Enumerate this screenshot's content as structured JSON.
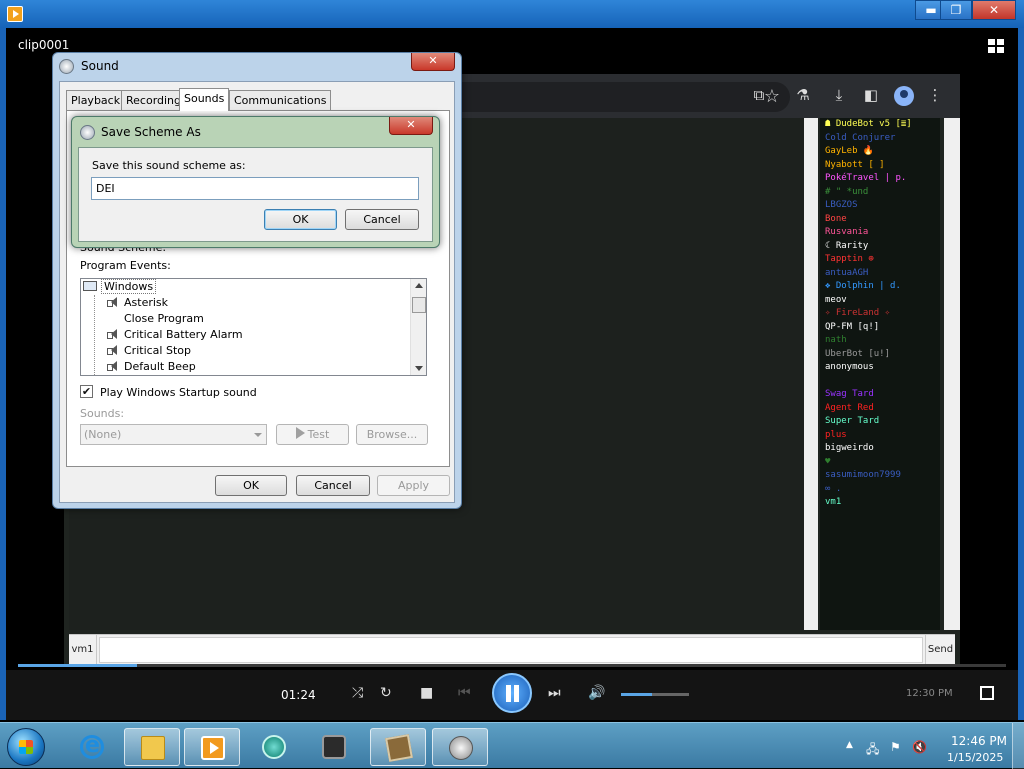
{
  "media_player": {
    "clip_name": "clip0001",
    "elapsed_time": "01:24",
    "progress": 0.12,
    "volume": 0.45,
    "window_controls": {
      "minimize": "▬",
      "maximize": "❐",
      "close": "✕"
    }
  },
  "chat": {
    "nick": "vm1",
    "send_label": "Send",
    "message_input_value": "",
    "users": [
      {
        "name": "☗ DudeBot v5 [≣]",
        "color": "#ffff55"
      },
      {
        "name": "Cold Conjurer",
        "color": "#3a5dc2"
      },
      {
        "name": "GayLeb 🔥",
        "color": "#ffb300"
      },
      {
        "name": "Nyabott [ ]",
        "color": "#ffb300"
      },
      {
        "name": "PokéTravel | p.",
        "color": "#ff55ff"
      },
      {
        "name": "# \" *und",
        "color": "#3a8f3a"
      },
      {
        "name": "LBGZOS",
        "color": "#3a5dc2"
      },
      {
        "name": "Bone",
        "color": "#ff4444"
      },
      {
        "name": "Rusvania",
        "color": "#ff5599"
      },
      {
        "name": "☾ Rarity",
        "color": "#ffffff"
      },
      {
        "name": "Tapptin ⊕",
        "color": "#ff3333"
      },
      {
        "name": "antuaAGH",
        "color": "#3a5dc2"
      },
      {
        "name": "❖ Dolphin | d.",
        "color": "#3399ff"
      },
      {
        "name": "meov",
        "color": "#ffffff"
      },
      {
        "name": "✧ FireLand ✧",
        "color": "#cc3333"
      },
      {
        "name": "QP-FM [q!]",
        "color": "#ffffff"
      },
      {
        "name": "nath",
        "color": "#2f7f2f"
      },
      {
        "name": "UberBot [u!]",
        "color": "#9a9a9a"
      },
      {
        "name": "anonymous",
        "color": "#ffffff"
      },
      {
        "name": "",
        "color": "#ffffff"
      },
      {
        "name": "Swag Tard",
        "color": "#9933ff"
      },
      {
        "name": "Agent Red",
        "color": "#ff2222"
      },
      {
        "name": "Super Tard",
        "color": "#66ffcc"
      },
      {
        "name": "plus",
        "color": "#ff2222"
      },
      {
        "name": "bigweirdo",
        "color": "#ffffff"
      },
      {
        "name": "♥",
        "color": "#2f7f2f"
      },
      {
        "name": "sasumimoon7999",
        "color": "#3a5dc2"
      },
      {
        "name": "∞ .",
        "color": "#3a5dc2"
      },
      {
        "name": "vm1",
        "color": "#66ffcc"
      }
    ]
  },
  "sound_dialog": {
    "title": "Sound",
    "close_label": "✕",
    "tabs": [
      "Playback",
      "Recording",
      "Sounds",
      "Communications"
    ],
    "active_tab": "Sounds",
    "sound_scheme_label": "Sound Scheme:",
    "program_events_label": "Program Events:",
    "events": [
      {
        "label": "Windows",
        "level": 0,
        "has_sound": false
      },
      {
        "label": "Asterisk",
        "level": 1,
        "has_sound": true
      },
      {
        "label": "Close Program",
        "level": 1,
        "has_sound": false
      },
      {
        "label": "Critical Battery Alarm",
        "level": 1,
        "has_sound": true
      },
      {
        "label": "Critical Stop",
        "level": 1,
        "has_sound": true
      },
      {
        "label": "Default Beep",
        "level": 1,
        "has_sound": true
      }
    ],
    "startup_checkbox_label": "Play Windows Startup sound",
    "startup_checked": true,
    "sounds_label": "Sounds:",
    "sounds_value": "(None)",
    "test_label": "Test",
    "browse_label": "Browse...",
    "ok_label": "OK",
    "cancel_label": "Cancel",
    "apply_label": "Apply"
  },
  "save_dialog": {
    "title": "Save Scheme As",
    "close_label": "✕",
    "prompt": "Save this sound scheme as:",
    "input_value": "DEI",
    "ok_label": "OK",
    "cancel_label": "Cancel"
  },
  "taskbar": {
    "time": "12:46 PM",
    "date": "1/15/2025",
    "dim_clock": "12:30 PM"
  }
}
